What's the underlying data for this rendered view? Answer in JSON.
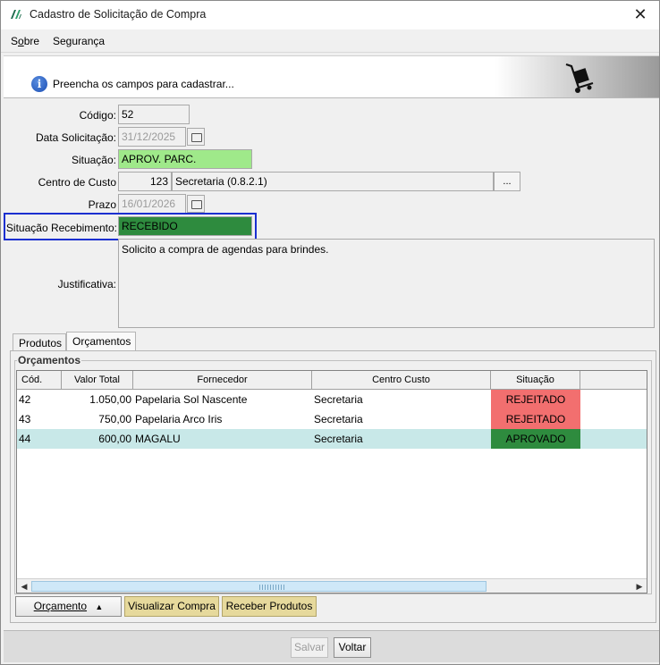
{
  "window": {
    "title": "Cadastro de Solicitação de Compra",
    "close_symbol": "✕"
  },
  "menu": {
    "items": [
      {
        "label": "Sobre",
        "mnemonic": "o"
      },
      {
        "label": "Segurança"
      }
    ]
  },
  "header": {
    "message": "Preencha os campos para cadastrar...",
    "icon": "info-icon",
    "illustration": "hand-truck-icon"
  },
  "form": {
    "codigo": {
      "label": "Código:",
      "value": "52"
    },
    "data_solicitacao": {
      "label": "Data Solicitação:",
      "value": "31/12/2025"
    },
    "situacao": {
      "label": "Situação:",
      "value": "APROV. PARC.",
      "color": "#9fe98a"
    },
    "centro_custo": {
      "label": "Centro de Custo",
      "code": "123",
      "name": "Secretaria (0.8.2.1)",
      "button": "..."
    },
    "prazo": {
      "label": "Prazo",
      "value": "16/01/2026"
    },
    "situacao_recebimento": {
      "label": "Situação Recebimento:",
      "value": "RECEBIDO",
      "color": "#2e8b3e"
    },
    "justificativa": {
      "label": "Justificativa:",
      "value": "Solicito a compra de agendas para brindes."
    }
  },
  "tabs": [
    {
      "label": "Produtos",
      "active": false
    },
    {
      "label": "Orçamentos",
      "active": true
    }
  ],
  "orcamentos": {
    "group_label": "Orçamentos",
    "columns": [
      "Cód.",
      "Valor Total",
      "Fornecedor",
      "Centro Custo",
      "Situação"
    ],
    "rows": [
      {
        "cod": "42",
        "valor": "1.050,00",
        "fornecedor": "Papelaria Sol Nascente",
        "centro": "Secretaria",
        "situacao": "REJEITADO",
        "status": "rejected",
        "selected": false
      },
      {
        "cod": "43",
        "valor": "750,00",
        "fornecedor": "Papelaria Arco Iris",
        "centro": "Secretaria",
        "situacao": "REJEITADO",
        "status": "rejected",
        "selected": false
      },
      {
        "cod": "44",
        "valor": "600,00",
        "fornecedor": "MAGALU",
        "centro": "Secretaria",
        "situacao": "APROVADO",
        "status": "approved",
        "selected": true
      }
    ],
    "status_colors": {
      "rejected": "#f26f6f",
      "approved": "#2e8b3e",
      "selected_row": "#c8e8e8"
    }
  },
  "actions": {
    "orcamento": "Orçamento",
    "visualizar": "Visualizar Compra",
    "receber": "Receber Produtos"
  },
  "footer": {
    "salvar": "Salvar",
    "voltar": "Voltar"
  }
}
